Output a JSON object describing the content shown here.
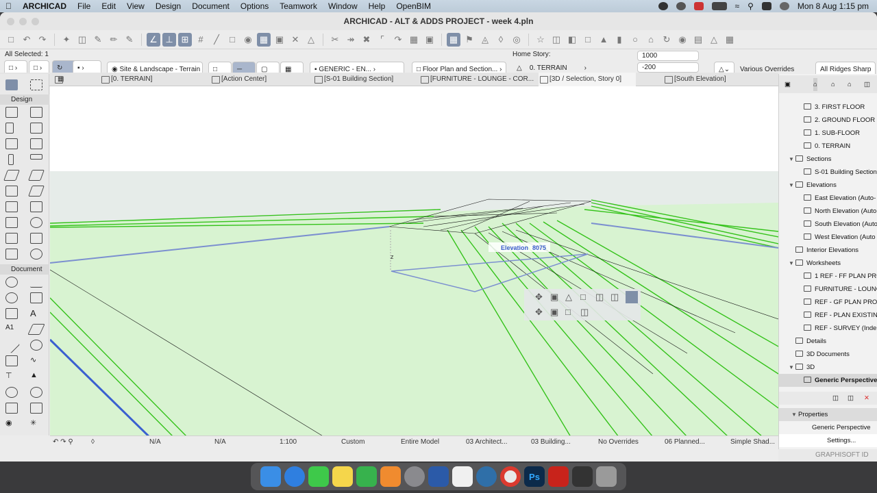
{
  "menubar": {
    "app": "ARCHICAD",
    "items": [
      "File",
      "Edit",
      "View",
      "Design",
      "Document",
      "Options",
      "Teamwork",
      "Window",
      "Help",
      "OpenBIM"
    ],
    "clock": "Mon 8 Aug  1:15 pm"
  },
  "window": {
    "title": "ARCHICAD - ALT & ADDS PROJECT - week 4.pln"
  },
  "info_box": {
    "selection": "All Selected: 1",
    "view_dropdown": "Site & Landscape - Terrain",
    "surface": "GENERIC - EN...",
    "floor_plan": "Floor Plan and Section...",
    "home_story_label": "Home Story:",
    "home_story_value": "0. TERRAIN",
    "value_top": "1000",
    "value_bottom": "-200",
    "overrides": "Various Overrides",
    "ridges": "All Ridges Sharp"
  },
  "tabs": [
    {
      "label": "[0. TERRAIN]"
    },
    {
      "label": "[Action Center]"
    },
    {
      "label": "[S-01 Building Section]"
    },
    {
      "label": "[FURNITURE - LOUNGE - COR..."
    },
    {
      "label": "[3D / Selection, Story 0]"
    },
    {
      "label": "[South Elevation]"
    }
  ],
  "toolbox": {
    "design_label": "Design",
    "document_label": "Document"
  },
  "viewport": {
    "elevation_label": "Elevation",
    "elevation_value": "8075",
    "axis_label": "z"
  },
  "statusbar": {
    "na1": "N/A",
    "na2": "N/A",
    "scale": "1:100",
    "custom": "Custom",
    "model": "Entire Model",
    "arch": "03 Architect...",
    "building": "03 Building...",
    "overrides": "No Overrides",
    "planned": "06 Planned...",
    "shading": "Simple Shad..."
  },
  "navigator": {
    "stories": [
      "3. FIRST FLOOR",
      "2. GROUND FLOOR",
      "1. SUB-FLOOR",
      "0. TERRAIN"
    ],
    "sections_label": "Sections",
    "sections": [
      "S-01 Building Section"
    ],
    "elevations_label": "Elevations",
    "elevations": [
      "East Elevation (Auto-",
      "North Elevation (Auto",
      "South Elevation (Auto",
      "West Elevation (Auto"
    ],
    "interior_elevations": "Interior Elevations",
    "worksheets_label": "Worksheets",
    "worksheets": [
      "1 REF - FF PLAN PRO",
      "FURNITURE - LOUNG",
      "REF - GF PLAN PROP",
      "REF - PLAN EXISTIN",
      "REF - SURVEY (Indep"
    ],
    "details": "Details",
    "documents_3d": "3D Documents",
    "label_3d": "3D",
    "perspective": "Generic Perspective",
    "properties_label": "Properties",
    "properties_value": "Generic Perspective",
    "settings": "Settings...",
    "brand": "GRAPHISOFT ID"
  },
  "colors": {
    "terrain": "#d6f5cf",
    "green_line": "#3cc51a",
    "blue_line": "#7b8fd0",
    "selection": "#7f8fa8"
  }
}
